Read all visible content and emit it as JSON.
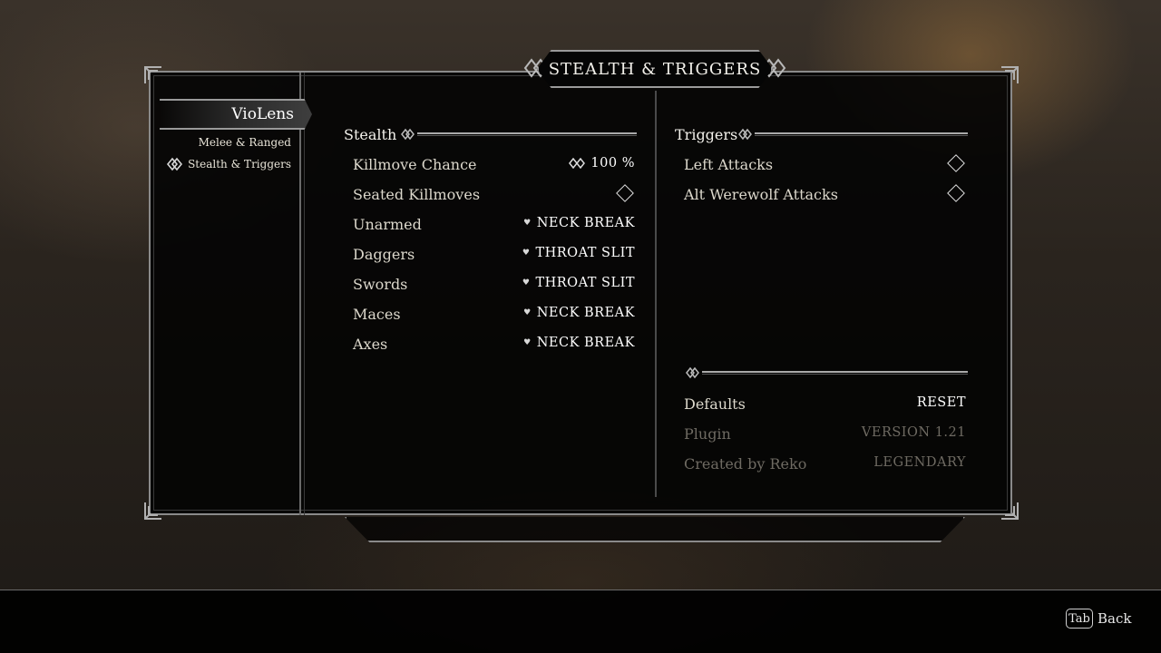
{
  "window": {
    "title": "STEALTH & TRIGGERS"
  },
  "sidebar": {
    "mod_name": "VioLens",
    "items": [
      {
        "label": "Melee & Ranged",
        "active": false
      },
      {
        "label": "Stealth & Triggers",
        "active": true,
        "icon": "knot-icon"
      }
    ]
  },
  "stealth": {
    "heading": "Stealth",
    "rows": [
      {
        "label": "Killmove Chance",
        "value": "100 %",
        "control": "slider",
        "icon": "double-diamond-icon"
      },
      {
        "label": "Seated Killmoves",
        "value": "",
        "control": "checkbox",
        "checked": false
      },
      {
        "label": "Unarmed",
        "value": "NECK BREAK",
        "control": "menu",
        "icon": "heart-icon"
      },
      {
        "label": "Daggers",
        "value": "THROAT SLIT",
        "control": "menu",
        "icon": "heart-icon"
      },
      {
        "label": "Swords",
        "value": "THROAT SLIT",
        "control": "menu",
        "icon": "heart-icon"
      },
      {
        "label": "Maces",
        "value": "NECK BREAK",
        "control": "menu",
        "icon": "heart-icon"
      },
      {
        "label": "Axes",
        "value": "NECK BREAK",
        "control": "menu",
        "icon": "heart-icon"
      }
    ]
  },
  "triggers": {
    "heading": "Triggers",
    "rows": [
      {
        "label": "Left Attacks",
        "control": "checkbox",
        "checked": false
      },
      {
        "label": "Alt Werewolf Attacks",
        "control": "checkbox",
        "checked": false
      }
    ]
  },
  "info": {
    "rows": [
      {
        "label": "Defaults",
        "value": "RESET",
        "enabled": true
      },
      {
        "label": "Plugin",
        "value": "VERSION 1.21",
        "enabled": false
      },
      {
        "label": "Created by Reko",
        "value": "LEGENDARY",
        "enabled": false
      }
    ]
  },
  "footer": {
    "key": "Tab",
    "action": "Back"
  }
}
